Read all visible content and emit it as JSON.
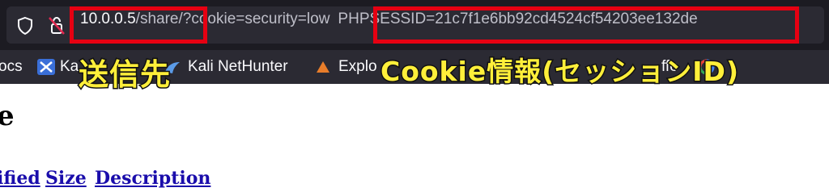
{
  "browser": {
    "url": {
      "host": "10.0.0.5",
      "path": "/share/",
      "query": "?cookie=security=low",
      "cookie": "PHPSESSID=21c7f1e6bb92cd4524cf54203ee132de"
    },
    "bookmarks": [
      {
        "label": "ocs"
      },
      {
        "label": "Ka"
      },
      {
        "label": "Kali NetHunter"
      },
      {
        "label": "Explo"
      },
      {
        "label": "ffe"
      }
    ]
  },
  "page": {
    "heading_fragment": "e",
    "columns": [
      "ified",
      "Size",
      "Description"
    ]
  },
  "annotations": {
    "destination_label": "送信先",
    "cookie_label": "Cookie情報(セッションID)"
  },
  "colors": {
    "annotation_border": "#e60012",
    "annotation_text": "#ffef3a",
    "link": "#1a0dab"
  }
}
